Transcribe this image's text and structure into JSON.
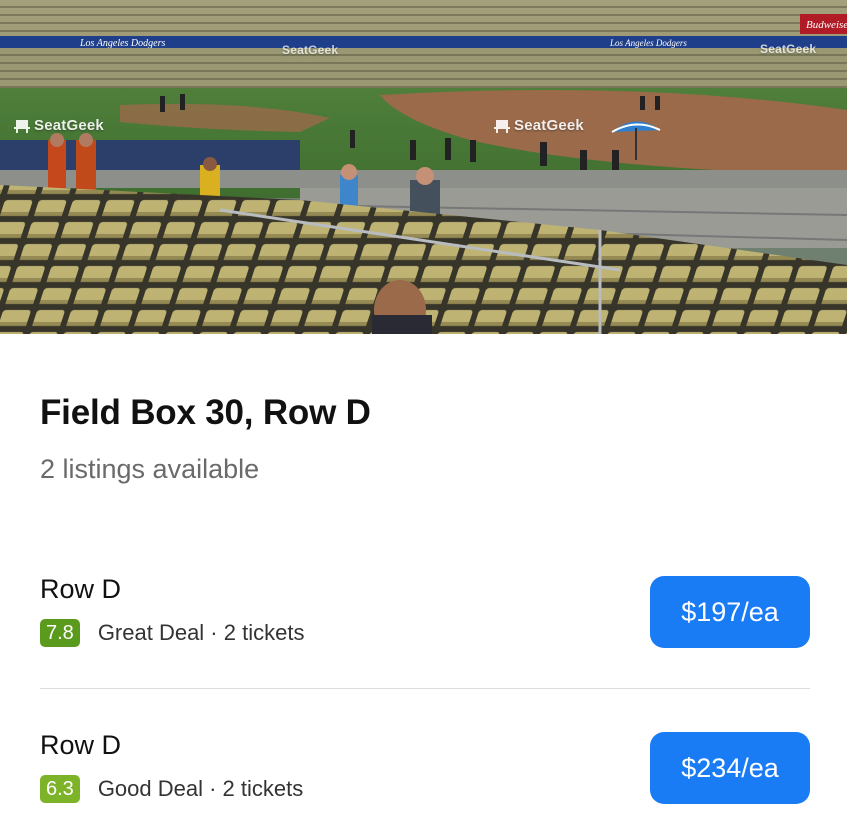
{
  "photo": {
    "watermark_label": "SeatGeek",
    "banner_text": "Los Angeles Dodgers",
    "sponsor_text": "Budweiser"
  },
  "section": {
    "title": "Field Box 30, Row D",
    "subtitle": "2 listings available"
  },
  "listings": [
    {
      "row": "Row D",
      "score": "7.8",
      "score_color": "#5a9a1c",
      "deal_text": "Great Deal · 2 tickets",
      "price": "$197/ea"
    },
    {
      "row": "Row D",
      "score": "6.3",
      "score_color": "#7cb328",
      "deal_text": "Good Deal · 2 tickets",
      "price": "$234/ea"
    }
  ],
  "colors": {
    "accent": "#1a7cf5",
    "divider": "#dddddd",
    "subtitle": "#6a6a6a"
  }
}
